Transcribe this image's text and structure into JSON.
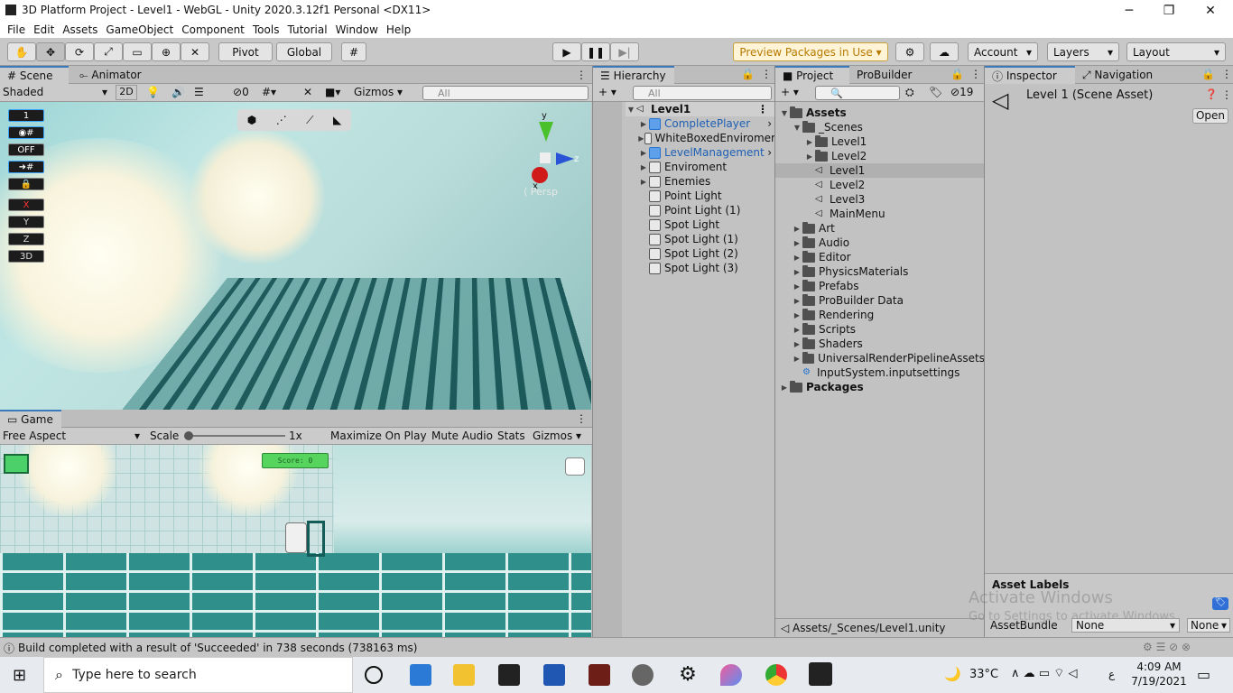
{
  "window": {
    "title": "3D Platform Project - Level1 - WebGL - Unity 2020.3.12f1 Personal <DX11>",
    "min": "─",
    "max": "❐",
    "close": "✕"
  },
  "menu": [
    "File",
    "Edit",
    "Assets",
    "GameObject",
    "Component",
    "Tools",
    "Tutorial",
    "Window",
    "Help"
  ],
  "toolbar": {
    "pivot": "Pivot",
    "global": "Global",
    "preview": "Preview Packages in Use",
    "account": "Account",
    "layers": "Layers",
    "layout": "Layout"
  },
  "scene": {
    "tab_scene": "Scene",
    "tab_animator": "Animator",
    "shading": "Shaded",
    "mode2d": "2D",
    "hidden_count": "0",
    "gizmos": "Gizmos",
    "search_placeholder": "All",
    "persp": "Persp",
    "axis_x": "x",
    "axis_y": "y",
    "axis_z": "z",
    "overlay": [
      "1",
      "",
      "OFF",
      "",
      "",
      "X",
      "Y",
      "Z",
      "3D"
    ]
  },
  "game": {
    "tab": "Game",
    "aspect": "Free Aspect",
    "scale_label": "Scale",
    "scale_value": "1x",
    "maximize": "Maximize On Play",
    "mute": "Mute Audio",
    "stats": "Stats",
    "gizmos": "Gizmos",
    "score": "Score: 0"
  },
  "hierarchy": {
    "tab": "Hierarchy",
    "search_placeholder": "All",
    "scene": "Level1",
    "items": [
      {
        "label": "CompletePlayer",
        "prefab": true,
        "expand": true
      },
      {
        "label": "WhiteBoxedEnviromer",
        "prefab": false,
        "expand": true
      },
      {
        "label": "LevelManagement",
        "prefab": true,
        "expand": true
      },
      {
        "label": "Enviroment",
        "prefab": false,
        "expand": true
      },
      {
        "label": "Enemies",
        "prefab": false,
        "expand": true
      },
      {
        "label": "Point Light",
        "prefab": false,
        "expand": false
      },
      {
        "label": "Point Light (1)",
        "prefab": false,
        "expand": false
      },
      {
        "label": "Spot Light",
        "prefab": false,
        "expand": false
      },
      {
        "label": "Spot Light (1)",
        "prefab": false,
        "expand": false
      },
      {
        "label": "Spot Light (2)",
        "prefab": false,
        "expand": false
      },
      {
        "label": "Spot Light (3)",
        "prefab": false,
        "expand": false
      }
    ]
  },
  "project": {
    "tab_project": "Project",
    "tab_probuilder": "ProBuilder",
    "hidden_count": "19",
    "path": "Assets/_Scenes/Level1.unity",
    "tree": [
      {
        "label": "Assets",
        "depth": 0,
        "kind": "folder",
        "bold": true,
        "open": true
      },
      {
        "label": "_Scenes",
        "depth": 1,
        "kind": "folder",
        "open": true
      },
      {
        "label": "Level1",
        "depth": 2,
        "kind": "folder"
      },
      {
        "label": "Level2",
        "depth": 2,
        "kind": "folder"
      },
      {
        "label": "Level1",
        "depth": 2,
        "kind": "scene",
        "selected": true
      },
      {
        "label": "Level2",
        "depth": 2,
        "kind": "scene"
      },
      {
        "label": "Level3",
        "depth": 2,
        "kind": "scene"
      },
      {
        "label": "MainMenu",
        "depth": 2,
        "kind": "scene"
      },
      {
        "label": "Art",
        "depth": 1,
        "kind": "folder"
      },
      {
        "label": "Audio",
        "depth": 1,
        "kind": "folder"
      },
      {
        "label": "Editor",
        "depth": 1,
        "kind": "folder"
      },
      {
        "label": "PhysicsMaterials",
        "depth": 1,
        "kind": "folder"
      },
      {
        "label": "Prefabs",
        "depth": 1,
        "kind": "folder"
      },
      {
        "label": "ProBuilder Data",
        "depth": 1,
        "kind": "folder"
      },
      {
        "label": "Rendering",
        "depth": 1,
        "kind": "folder"
      },
      {
        "label": "Scripts",
        "depth": 1,
        "kind": "folder"
      },
      {
        "label": "Shaders",
        "depth": 1,
        "kind": "folder"
      },
      {
        "label": "UniversalRenderPipelineAssets",
        "depth": 1,
        "kind": "folder"
      },
      {
        "label": "InputSystem.inputsettings",
        "depth": 1,
        "kind": "asset"
      },
      {
        "label": "Packages",
        "depth": 0,
        "kind": "folder",
        "bold": true
      }
    ]
  },
  "inspector": {
    "tab_inspector": "Inspector",
    "tab_navigation": "Navigation",
    "title": "Level 1 (Scene Asset)",
    "open": "Open",
    "asset_labels": "Asset Labels",
    "asset_bundle": "AssetBundle",
    "bundle_value": "None",
    "variant_value": "None",
    "watermark1": "Activate Windows",
    "watermark2": "Go to Settings to activate Windows."
  },
  "status": {
    "message": "Build completed with a result of 'Succeeded' in 738 seconds (738163 ms)"
  },
  "taskbar": {
    "search_placeholder": "Type here to search",
    "temp": "33°C",
    "time": "4:09 AM",
    "date": "7/19/2021",
    "lang": "ع"
  }
}
